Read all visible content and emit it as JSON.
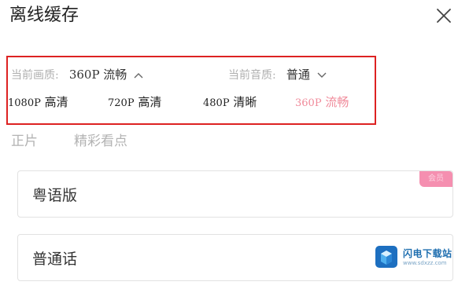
{
  "header": {
    "title": "离线缓存",
    "close_icon": "close-icon"
  },
  "quality": {
    "current_video_label": "当前画质:",
    "current_video_value": "360P 流畅",
    "current_audio_label": "当前音质:",
    "current_audio_value": "普通",
    "options": [
      {
        "res": "1080P",
        "name": "高清",
        "selected": false
      },
      {
        "res": "720P",
        "name": "高清",
        "selected": false
      },
      {
        "res": "480P",
        "name": "清晰",
        "selected": false
      },
      {
        "res": "360P",
        "name": "流畅",
        "selected": true
      }
    ]
  },
  "tabs": [
    {
      "label": "正片"
    },
    {
      "label": "精彩看点"
    }
  ],
  "versions": [
    {
      "label": "粤语版",
      "badge": "会员"
    },
    {
      "label": "普通话"
    }
  ],
  "watermark": {
    "name": "闪电下载站",
    "url": "www.sdxzz.com"
  },
  "colors": {
    "highlight_border": "#dd2222",
    "selected_option": "#f08a9a",
    "badge_bg": "#f58fb0"
  }
}
